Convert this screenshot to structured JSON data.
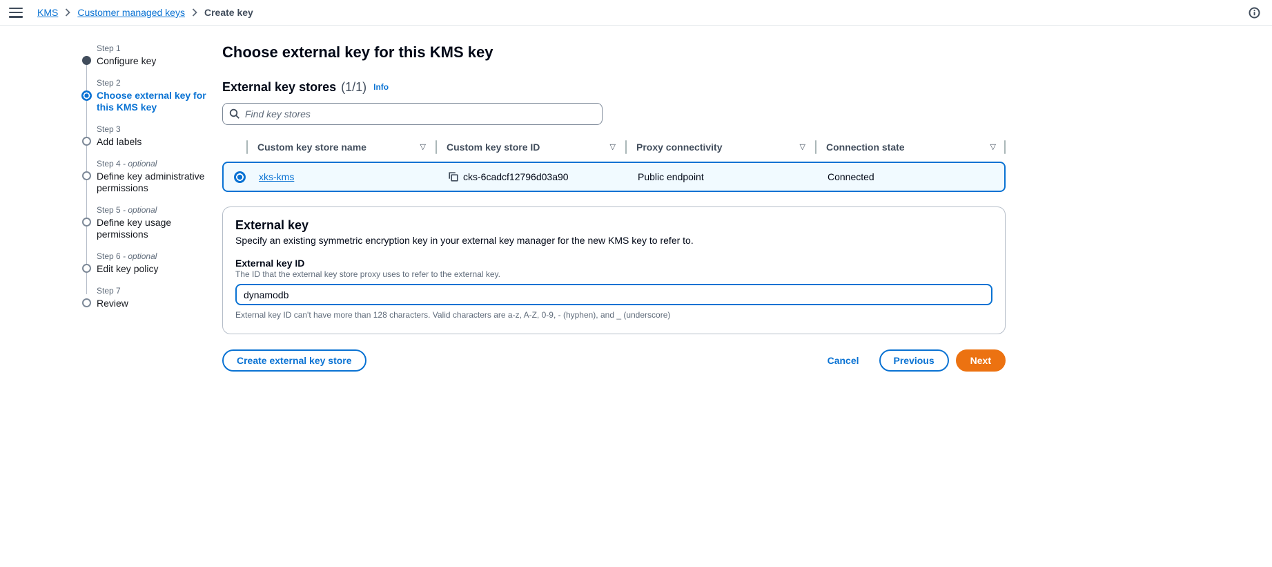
{
  "topbar": {
    "breadcrumbs": [
      {
        "label": "KMS"
      },
      {
        "label": "Customer managed keys"
      },
      {
        "label": "Create key"
      }
    ]
  },
  "steps": [
    {
      "step": "Step 1",
      "title": "Configure key",
      "state": "completed"
    },
    {
      "step": "Step 2",
      "title": "Choose external key for this KMS key",
      "state": "active"
    },
    {
      "step": "Step 3",
      "title": "Add labels",
      "state": "upcoming"
    },
    {
      "step": "Step 4",
      "optional": "- optional",
      "title": "Define key administrative permissions",
      "state": "upcoming"
    },
    {
      "step": "Step 5",
      "optional": "- optional",
      "title": "Define key usage permissions",
      "state": "upcoming"
    },
    {
      "step": "Step 6",
      "optional": "- optional",
      "title": "Edit key policy",
      "state": "upcoming"
    },
    {
      "step": "Step 7",
      "title": "Review",
      "state": "upcoming"
    }
  ],
  "main": {
    "page_title": "Choose external key for this KMS key",
    "key_stores": {
      "title": "External key stores",
      "count": "(1/1)",
      "info_label": "Info",
      "search_placeholder": "Find key stores",
      "columns": [
        "Custom key store name",
        "Custom key store ID",
        "Proxy connectivity",
        "Connection state"
      ],
      "sort_icon": "▽",
      "rows": [
        {
          "name": "xks-kms",
          "id": "cks-6cadcf12796d03a90",
          "proxy_connectivity": "Public endpoint",
          "connection_state": "Connected",
          "selected": true
        }
      ]
    },
    "external_key": {
      "title": "External key",
      "description": "Specify an existing symmetric encryption key in your external key manager for the new KMS key to refer to.",
      "field_label": "External key ID",
      "field_description": "The ID that the external key store proxy uses to refer to the external key.",
      "field_value": "dynamodb",
      "constraint": "External key ID can't have more than 128 characters. Valid characters are a-z, A-Z, 0-9, - (hyphen), and _ (underscore)"
    },
    "actions": {
      "create_store": "Create external key store",
      "cancel": "Cancel",
      "previous": "Previous",
      "next": "Next"
    }
  },
  "colors": {
    "accent_blue": "#0972d3",
    "primary_button_orange": "#ec7211",
    "selected_row_bg": "#f1faff",
    "text_dark": "#000716",
    "text_gray": "#5f6b7a"
  }
}
